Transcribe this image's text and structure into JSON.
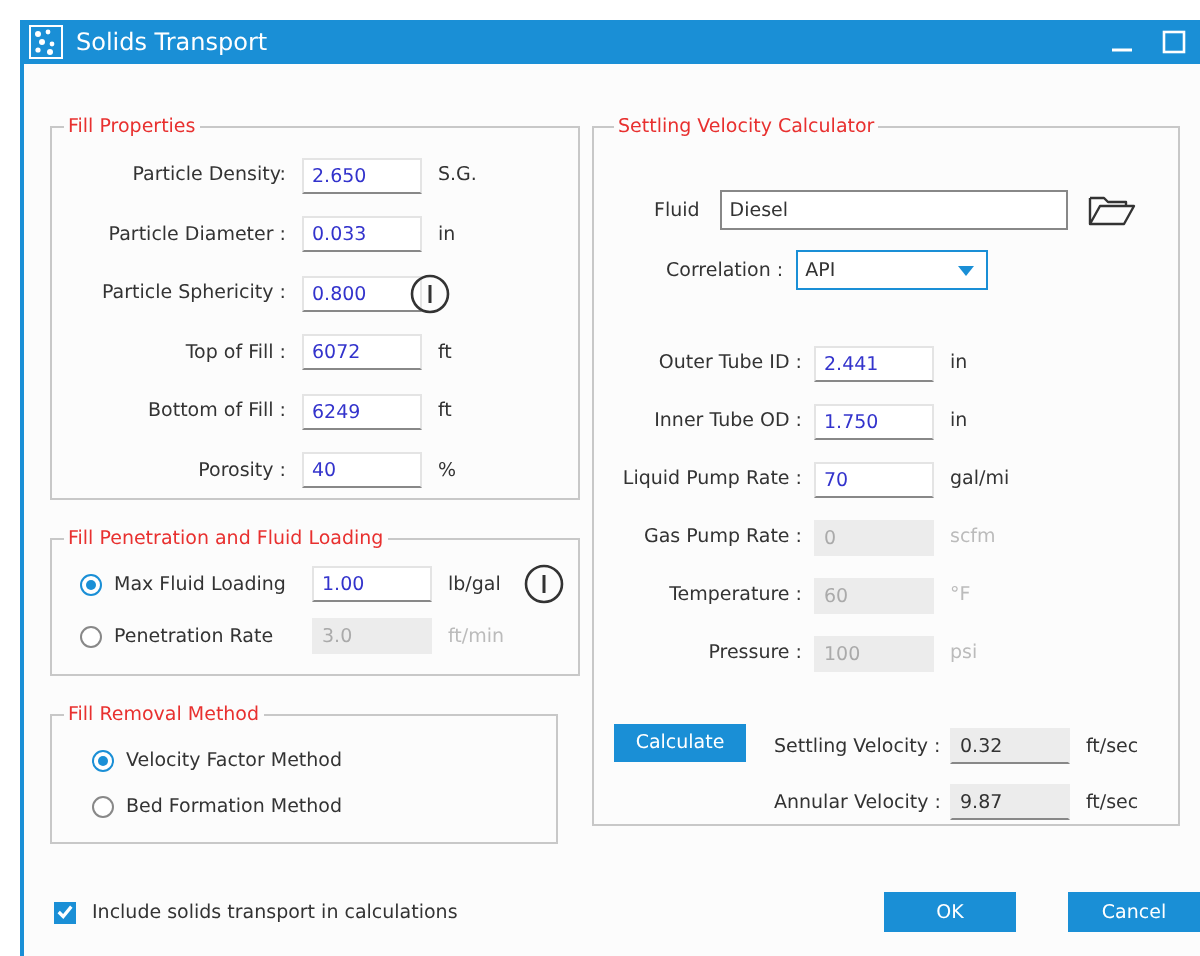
{
  "window": {
    "title": "Solids Transport"
  },
  "fill_properties": {
    "title": "Fill Properties",
    "fields": [
      {
        "label": "Particle Density:",
        "value": "2.650",
        "unit": "S.G.",
        "info": false
      },
      {
        "label": "Particle Diameter :",
        "value": "0.033",
        "unit": "in",
        "info": false
      },
      {
        "label": "Particle Sphericity :",
        "value": "0.800",
        "info": true
      },
      {
        "label": "Top of Fill :",
        "value": "6072",
        "unit": "ft",
        "info": false
      },
      {
        "label": "Bottom of Fill :",
        "value": "6249",
        "unit": "ft",
        "info": false
      },
      {
        "label": "Porosity :",
        "value": "40",
        "unit": "%",
        "info": false
      }
    ]
  },
  "penetration": {
    "title": "Fill Penetration and Fluid Loading",
    "options": [
      {
        "label": "Max Fluid Loading",
        "selected": true,
        "value": "1.00",
        "unit": "lb/gal",
        "disabled": false,
        "info": true
      },
      {
        "label": "Penetration Rate",
        "selected": false,
        "value": "3.0",
        "unit": "ft/min",
        "disabled": true,
        "info": false
      }
    ]
  },
  "removal": {
    "title": "Fill Removal Method",
    "options": [
      {
        "label": "Velocity Factor Method",
        "selected": true
      },
      {
        "label": "Bed Formation Method",
        "selected": false
      }
    ]
  },
  "calculator": {
    "title": "Settling Velocity Calculator",
    "fluid": {
      "label": "Fluid",
      "value": "Diesel"
    },
    "correlation": {
      "label": "Correlation :",
      "value": "API"
    },
    "fields": [
      {
        "label": "Outer Tube ID :",
        "value": "2.441",
        "unit": "in",
        "disabled": false
      },
      {
        "label": "Inner Tube OD :",
        "value": "1.750",
        "unit": "in",
        "disabled": false
      },
      {
        "label": "Liquid Pump Rate :",
        "value": "70",
        "unit": "gal/mi",
        "disabled": false
      },
      {
        "label": "Gas Pump Rate :",
        "value": "0",
        "unit": "scfm",
        "disabled": true
      },
      {
        "label": "Temperature :",
        "value": "60",
        "unit": "°F",
        "disabled": true
      },
      {
        "label": "Pressure :",
        "value": "100",
        "unit": "psi",
        "disabled": true
      }
    ],
    "calculate_button": "Calculate",
    "results": [
      {
        "label": "Settling Velocity :",
        "value": "0.32",
        "unit": "ft/sec"
      },
      {
        "label": "Annular Velocity :",
        "value": "9.87",
        "unit": "ft/sec"
      }
    ]
  },
  "include_checkbox": {
    "label": "Include solids transport in calculations",
    "checked": true
  },
  "buttons": [
    "OK",
    "Cancel"
  ]
}
